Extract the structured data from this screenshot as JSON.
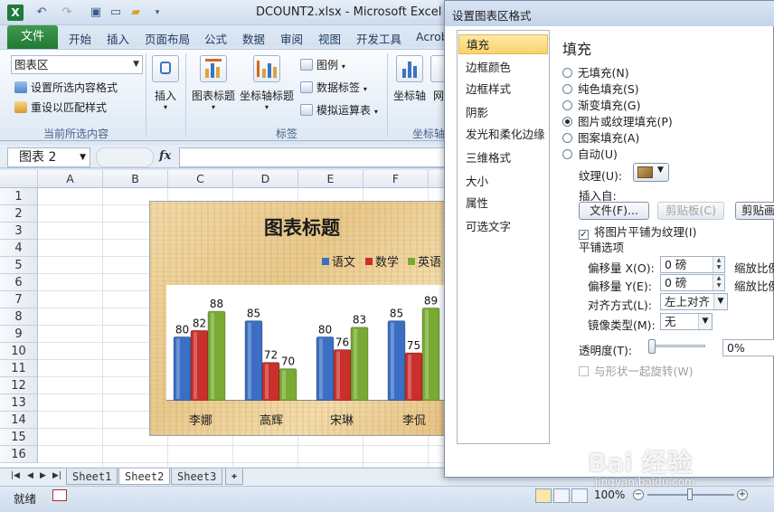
{
  "app": {
    "window_title": "DCOUNT2.xlsx - Microsoft Excel",
    "logo_letter": "X",
    "tabs": [
      "文件",
      "开始",
      "插入",
      "页面布局",
      "公式",
      "数据",
      "审阅",
      "视图",
      "开发工具",
      "Acrob"
    ]
  },
  "ribbon": {
    "chart_element_value": "图表区",
    "format_selection_label": "设置所选内容格式",
    "reset_style_label": "重设以匹配样式",
    "current_selection_group": "当前所选内容",
    "insert_label": "插入",
    "chart_title_label": "图表标题",
    "axis_title_label": "坐标轴标题",
    "legend_label": "图例",
    "data_labels_label": "数据标签",
    "data_table_label": "模拟运算表",
    "labels_group": "标签",
    "axes_label": "坐标轴",
    "gridlines_label_partial": "网",
    "axes_group_partial": "坐标轴"
  },
  "formula_bar": {
    "name_box": "图表 2",
    "fx": "fx",
    "value": ""
  },
  "grid": {
    "columns": [
      "A",
      "B",
      "C",
      "D",
      "E",
      "F"
    ],
    "rows": [
      "1",
      "2",
      "3",
      "4",
      "5",
      "6",
      "7",
      "8",
      "9",
      "10",
      "11",
      "12",
      "13",
      "14",
      "15",
      "16"
    ]
  },
  "chart_data": {
    "type": "bar",
    "title": "图表标题",
    "categories": [
      "李娜",
      "高辉",
      "宋琳",
      "李侃"
    ],
    "series": [
      {
        "name": "语文",
        "values": [
          80,
          85,
          80,
          85
        ],
        "color": "#3b6fc4"
      },
      {
        "name": "数学",
        "values": [
          82,
          72,
          76,
          75
        ],
        "color": "#c9302c"
      },
      {
        "name": "英语",
        "values": [
          88,
          70,
          83,
          89
        ],
        "color": "#7aaa32"
      }
    ],
    "ylim": [
      60,
      90
    ],
    "legend": "top"
  },
  "sheets": {
    "tabs": [
      "Sheet1",
      "Sheet2",
      "Sheet3"
    ],
    "active": "Sheet2"
  },
  "status": {
    "ready": "就绪",
    "zoom": "100%"
  },
  "dialog": {
    "title": "设置图表区格式",
    "nav": [
      "填充",
      "边框颜色",
      "边框样式",
      "阴影",
      "发光和柔化边缘",
      "三维格式",
      "大小",
      "属性",
      "可选文字"
    ],
    "heading": "填充",
    "fill_options": [
      {
        "label": "无填充(N)",
        "checked": false
      },
      {
        "label": "纯色填充(S)",
        "checked": false
      },
      {
        "label": "渐变填充(G)",
        "checked": false
      },
      {
        "label": "图片或纹理填充(P)",
        "checked": true
      },
      {
        "label": "图案填充(A)",
        "checked": false
      },
      {
        "label": "自动(U)",
        "checked": false
      }
    ],
    "texture_label": "纹理(U):",
    "insert_from_label": "插入自:",
    "file_button": "文件(F)...",
    "clipboard_button": "剪贴板(C)",
    "clipart_button": "剪贴画",
    "tile_checkbox_label": "将图片平铺为纹理(I)",
    "tile_options_label": "平铺选项",
    "offset_x_label": "偏移量 X(O):",
    "offset_x_value": "0 磅",
    "offset_y_label": "偏移量 Y(E):",
    "offset_y_value": "0 磅",
    "scale_x_label": "缩放比例",
    "scale_y_label": "缩放比例",
    "alignment_label": "对齐方式(L):",
    "alignment_value": "左上对齐",
    "mirror_label": "镜像类型(M):",
    "mirror_value": "无",
    "transparency_label": "透明度(T):",
    "transparency_value": "0%",
    "rotate_with_shape_label": "与形状一起旋转(W)"
  },
  "watermark": {
    "text": "Bai 经验",
    "sub": "jingyan.baidu.com"
  }
}
